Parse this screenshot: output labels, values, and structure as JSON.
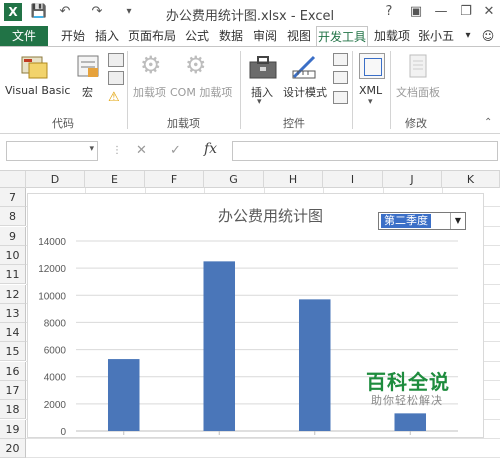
{
  "window": {
    "title": "办公费用统计图.xlsx - Excel"
  },
  "title_controls": {
    "help": "?",
    "minimize": "—",
    "restore": "❐",
    "close": "✕"
  },
  "quick_access": {
    "save": "💾",
    "undo": "↶",
    "redo": "↷"
  },
  "tabs": [
    {
      "label": "文件"
    },
    {
      "label": "开始"
    },
    {
      "label": "插入"
    },
    {
      "label": "页面布局"
    },
    {
      "label": "公式"
    },
    {
      "label": "数据"
    },
    {
      "label": "审阅"
    },
    {
      "label": "视图"
    },
    {
      "label": "开发工具"
    },
    {
      "label": "加载项"
    },
    {
      "label": "张小五"
    }
  ],
  "ribbon": {
    "visual_basic": "Visual Basic",
    "macro": "宏",
    "addins": "加载项",
    "com_addins": "COM 加载项",
    "insert": "插入",
    "design_mode": "设计模式",
    "xml": "XML",
    "doc_panel": "文档面板",
    "groups": {
      "code": "代码",
      "addins": "加载项",
      "controls": "控件",
      "modify": "修改"
    }
  },
  "formula_bar": {
    "fx": "fx",
    "cancel": "✕",
    "enter": "✓",
    "value": ""
  },
  "columns": [
    "D",
    "E",
    "F",
    "G",
    "H",
    "I",
    "J",
    "K"
  ],
  "rows": [
    "7",
    "8",
    "9",
    "10",
    "11",
    "12",
    "13",
    "14",
    "15",
    "16",
    "17",
    "18",
    "19",
    "20"
  ],
  "chart_data": {
    "type": "bar",
    "title": "办公费用统计图",
    "categories": [
      "",
      "",
      "",
      ""
    ],
    "values": [
      5300,
      12500,
      9700,
      1300
    ],
    "ylim": [
      0,
      14000
    ],
    "yticks": [
      "0",
      "2000",
      "4000",
      "6000",
      "8000",
      "10000",
      "12000",
      "14000"
    ],
    "bar_color": "#4a76b9",
    "grid": true
  },
  "dropdown": {
    "value": "第二季度"
  },
  "watermark": {
    "main": "百科全说",
    "sub": "助你轻松解决"
  }
}
